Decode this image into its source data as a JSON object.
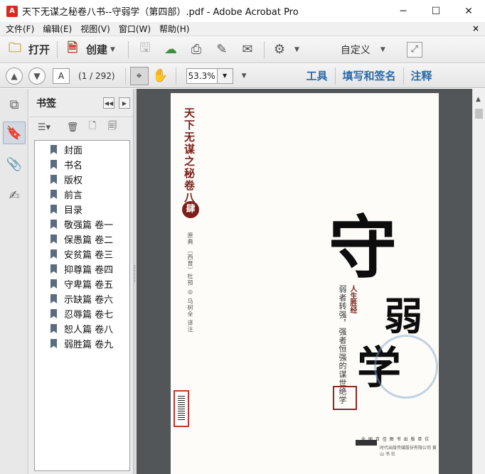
{
  "window": {
    "title": "天下无谋之秘卷八书--守弱学（第四部）.pdf - Adobe Acrobat Pro",
    "min_glyph": "─",
    "max_glyph": "☐",
    "close_glyph": "✕"
  },
  "menu": {
    "items": [
      "文件(F)",
      "编辑(E)",
      "视图(V)",
      "窗口(W)",
      "帮助(H)"
    ],
    "close_glyph": "×"
  },
  "toolbar": {
    "open_label": "打开",
    "create_label": "创建",
    "custom_label": "自定义",
    "icons": [
      "folder-icon",
      "create-pdf-icon",
      "save-icon",
      "upload-icon",
      "print-icon",
      "edit-icon",
      "email-icon",
      "gear-icon"
    ]
  },
  "nav": {
    "page_value": "A",
    "page_count": "(1 / 292)",
    "zoom": "53.3%",
    "tools_label": "工具",
    "fill_sign_label": "填写和签名",
    "comment_label": "注释"
  },
  "bookmarks": {
    "title": "书签",
    "items": [
      "封面",
      "书名",
      "版权",
      "前言",
      "目录",
      "敬强篇 卷一",
      "保愚篇 卷二",
      "安贫篇 卷三",
      "抑尊篇 卷四",
      "守卑篇 卷五",
      "示缺篇 卷六",
      "忍辱篇 卷七",
      "恕人篇 卷八",
      "弱胜篇 卷九"
    ]
  },
  "cover": {
    "series_title": "天下无谋之秘卷八书",
    "volume_seal": "肆",
    "author_line": "原典 〔西晋〕杜预 ◎ 马树全 译注",
    "char1": "守",
    "char2": "弱",
    "char3": "学",
    "subtitle_red": "人生胜经",
    "subtitle": "弱者转强，强者恒强的谋世绝学",
    "publisher_line1": "全 国 百 佳 图 书 出 版 单 位",
    "publisher_line2": "时代出版传媒股份有限公司 黄 山 书 社"
  }
}
